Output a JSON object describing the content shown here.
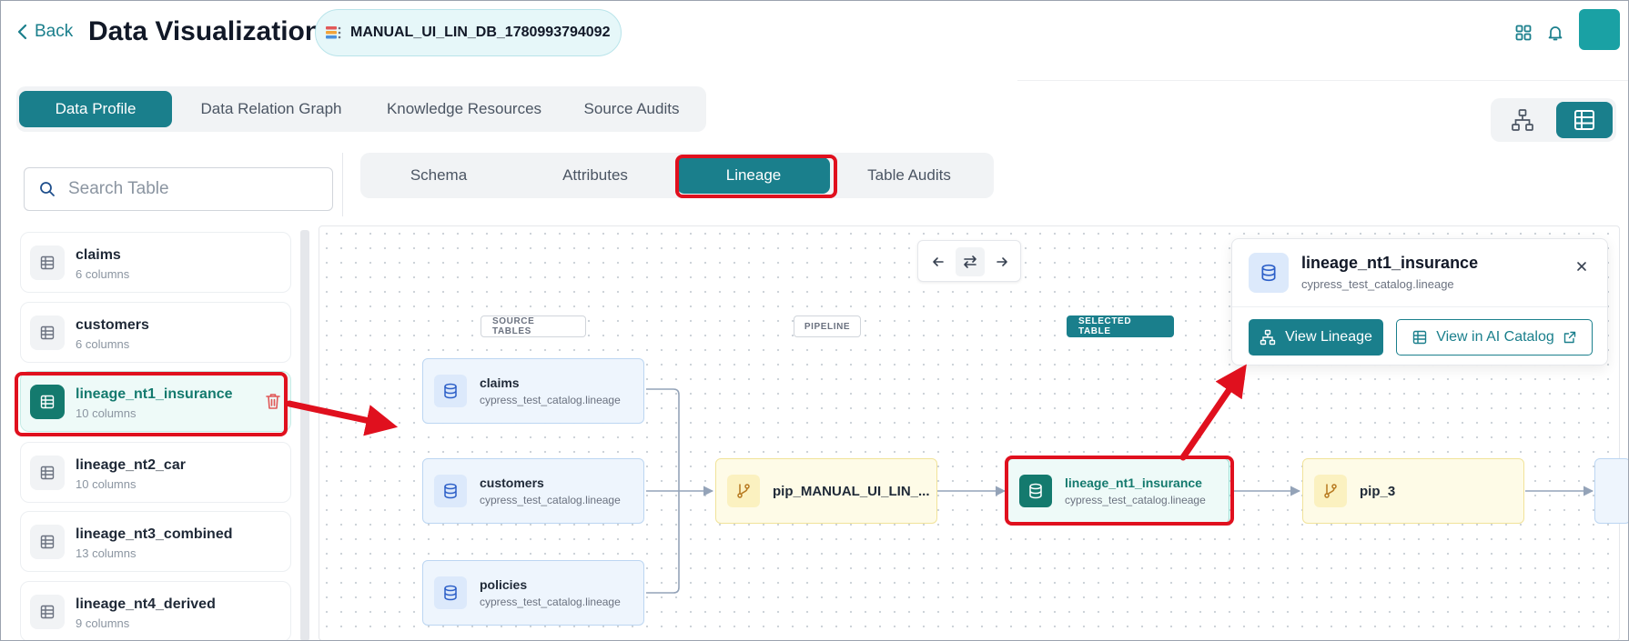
{
  "header": {
    "back_label": "Back",
    "title": "Data Visualization",
    "database_name": "MANUAL_UI_LIN_DB_1780993794092",
    "icons": [
      "db-icon",
      "grid-icon",
      "bell-icon",
      "avatar"
    ]
  },
  "main_tabs": [
    {
      "label": "Data Profile",
      "active": true
    },
    {
      "label": "Data Relation Graph",
      "active": false
    },
    {
      "label": "Knowledge Resources",
      "active": false
    },
    {
      "label": "Source Audits",
      "active": false
    }
  ],
  "view_toggle": {
    "options": [
      "hierarchy-icon",
      "table-grid-icon"
    ],
    "active": "table-grid-icon"
  },
  "search": {
    "placeholder": "Search Table",
    "value": ""
  },
  "tables": [
    {
      "name": "claims",
      "columns": "6 columns",
      "selected": false
    },
    {
      "name": "customers",
      "columns": "6 columns",
      "selected": false
    },
    {
      "name": "lineage_nt1_insurance",
      "columns": "10 columns",
      "selected": true
    },
    {
      "name": "lineage_nt2_car",
      "columns": "10 columns",
      "selected": false
    },
    {
      "name": "lineage_nt3_combined",
      "columns": "13 columns",
      "selected": false
    },
    {
      "name": "lineage_nt4_derived",
      "columns": "9 columns",
      "selected": false
    }
  ],
  "sub_tabs": [
    {
      "label": "Schema",
      "active": false
    },
    {
      "label": "Attributes",
      "active": false
    },
    {
      "label": "Lineage",
      "active": true
    },
    {
      "label": "Table Audits",
      "active": false
    }
  ],
  "lineage": {
    "nav_controls": [
      "arrow-left-icon",
      "swap-icon",
      "arrow-right-icon"
    ],
    "column_labels": {
      "source": "SOURCE TABLES",
      "pipeline": "PIPELINE",
      "selected": "SELECTED TABLE"
    },
    "sources": [
      {
        "name": "claims",
        "sub": "cypress_test_catalog.lineage"
      },
      {
        "name": "customers",
        "sub": "cypress_test_catalog.lineage"
      },
      {
        "name": "policies",
        "sub": "cypress_test_catalog.lineage"
      }
    ],
    "pipeline": {
      "name": "pip_MANUAL_UI_LIN_..."
    },
    "selected": {
      "name": "lineage_nt1_insurance",
      "sub": "cypress_test_catalog.lineage"
    },
    "downstream_pipeline": {
      "name": "pip_3"
    }
  },
  "popup": {
    "name": "lineage_nt1_insurance",
    "sub": "cypress_test_catalog.lineage",
    "view_lineage_label": "View Lineage",
    "view_catalog_label": "View in AI Catalog"
  },
  "colors": {
    "accent": "#1a7f8c",
    "selected": "#147a6e",
    "annotation": "#e0101e",
    "source_node": "#eef5fd",
    "pipeline_node": "#fefbe7"
  }
}
